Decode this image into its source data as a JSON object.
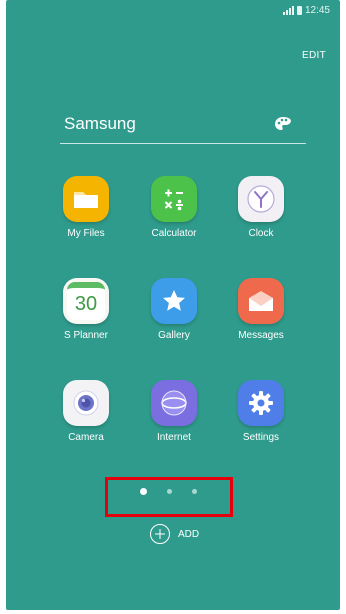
{
  "status_bar": {
    "time": "12:45"
  },
  "header": {
    "edit_label": "EDIT"
  },
  "folder": {
    "title": "Samsung"
  },
  "apps": [
    {
      "label": "My Files",
      "icon": "folder-icon",
      "color": "#f5b400"
    },
    {
      "label": "Calculator",
      "icon": "calculator-icon",
      "color": "#4cc24a"
    },
    {
      "label": "Clock",
      "icon": "clock-icon",
      "color": "#f2f0f4"
    },
    {
      "label": "S Planner",
      "icon": "calendar-icon",
      "day": "30",
      "color": "#f7f7f4"
    },
    {
      "label": "Gallery",
      "icon": "star-icon",
      "color": "#3d9de8"
    },
    {
      "label": "Messages",
      "icon": "envelope-icon",
      "color": "#ef6a4d"
    },
    {
      "label": "Camera",
      "icon": "camera-icon",
      "color": "#f3f3f6"
    },
    {
      "label": "Internet",
      "icon": "globe-icon",
      "color": "#7a6ee0"
    },
    {
      "label": "Settings",
      "icon": "gear-icon",
      "color": "#4f7ee8"
    }
  ],
  "pagination": {
    "pages": 3,
    "active_index": 0
  },
  "footer": {
    "add_label": "ADD"
  },
  "colors": {
    "background": "#2f9b8c",
    "highlight": "#e5000b"
  }
}
